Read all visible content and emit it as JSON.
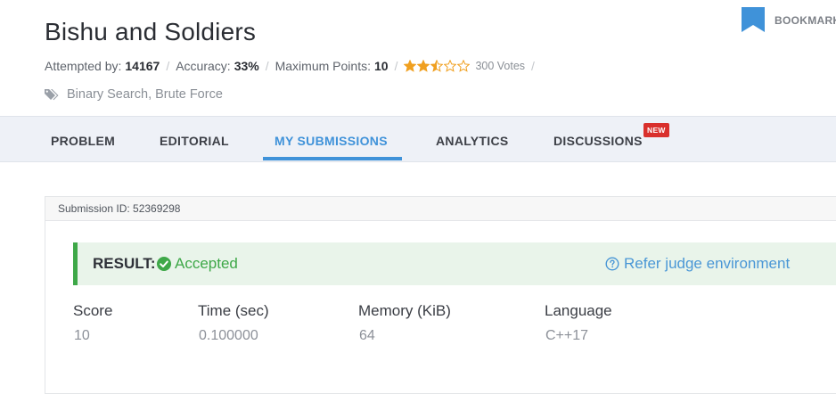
{
  "problem": {
    "title": "Bishu and Soldiers",
    "bookmark_label": "BOOKMARK",
    "meta": {
      "attempted_label": "Attempted by:",
      "attempted_value": "14167",
      "accuracy_label": "Accuracy:",
      "accuracy_value": "33%",
      "max_points_label": "Maximum Points:",
      "max_points_value": "10",
      "rating": 2.5,
      "rating_max": 5,
      "votes": "300 Votes"
    },
    "tags": "Binary Search, Brute Force"
  },
  "tabs": [
    {
      "label": "PROBLEM",
      "active": false
    },
    {
      "label": "EDITORIAL",
      "active": false
    },
    {
      "label": "MY SUBMISSIONS",
      "active": true
    },
    {
      "label": "ANALYTICS",
      "active": false
    },
    {
      "label": "DISCUSSIONS",
      "active": false,
      "badge": "NEW"
    }
  ],
  "submission": {
    "id_text": "Submission ID: 52369298",
    "result_label": "RESULT:",
    "result_value": "Accepted",
    "judge_link": "Refer judge environment",
    "stats": [
      {
        "label": "Score",
        "value": "10"
      },
      {
        "label": "Time (sec)",
        "value": "0.100000"
      },
      {
        "label": "Memory (KiB)",
        "value": "64"
      },
      {
        "label": "Language",
        "value": "C++17"
      }
    ]
  },
  "colors": {
    "accent": "#3f92d9",
    "success": "#3ea848",
    "badge": "#d9302c",
    "star": "#f0a020"
  },
  "icons": {
    "bookmark": "bookmark-icon",
    "star_full": "star-icon",
    "star_half": "half-star-icon",
    "star_empty": "empty-star-icon",
    "tag": "tag-icon",
    "check": "check-circle-icon",
    "help": "question-circle-icon"
  }
}
